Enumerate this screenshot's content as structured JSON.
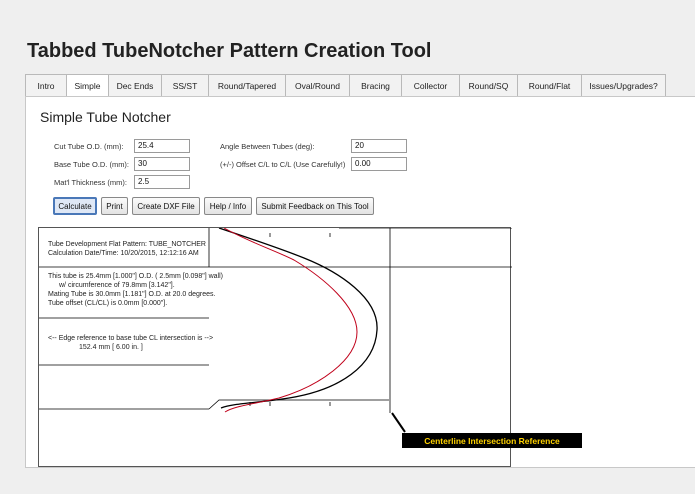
{
  "app": {
    "title": "Tabbed TubeNotcher Pattern Creation Tool"
  },
  "tabs": [
    {
      "label": "Intro",
      "active": false
    },
    {
      "label": "Simple",
      "active": true
    },
    {
      "label": "Dec Ends",
      "active": false
    },
    {
      "label": "SS/ST",
      "active": false
    },
    {
      "label": "Round/Tapered",
      "active": false
    },
    {
      "label": "Oval/Round",
      "active": false
    },
    {
      "label": "Bracing",
      "active": false
    },
    {
      "label": "Collector",
      "active": false
    },
    {
      "label": "Round/SQ",
      "active": false
    },
    {
      "label": "Round/Flat",
      "active": false
    },
    {
      "label": "Issues/Upgrades?",
      "active": false
    }
  ],
  "section": {
    "title": "Simple Tube Notcher"
  },
  "form": {
    "cut_tube_od": {
      "label": "Cut Tube O.D. (mm):",
      "value": "25.4"
    },
    "base_tube_od": {
      "label": "Base Tube O.D. (mm):",
      "value": "30"
    },
    "matl_thickness": {
      "label": "Mat'l Thickness (mm):",
      "value": "2.5"
    },
    "angle": {
      "label": "Angle Between Tubes (deg):",
      "value": "20"
    },
    "offset": {
      "label": "(+/-) Offset C/L to C/L (Use Carefully!)",
      "value": "0.00"
    }
  },
  "buttons": {
    "calculate": "Calculate",
    "print": "Print",
    "create_dxf": "Create DXF File",
    "help": "Help / Info",
    "feedback": "Submit Feedback on This Tool"
  },
  "pattern": {
    "header_line1": "Tube Development Flat Pattern: TUBE_NOTCHER",
    "header_line2": "Calculation Date/Time: 10/20/2015, 12:12:16 AM",
    "info_line1": "This tube is 25.4mm [1.000\"] O.D.     ( 2.5mm [0.098\"] wall)",
    "info_line2": "w/ circumference of 79.8mm [3.142\"].",
    "info_line3": "Mating Tube is 30.0mm [1.181\"] O.D. at 20.0 degrees.",
    "info_line4": "Tube offset (CL/CL) is 0.0mm [0.000\"].",
    "edge_ref": "<-- Edge reference to base tube CL intersection is -->",
    "edge_dist": "152.4 mm   [ 6.00 in. ]",
    "ref_label": "Centerline Intersection Reference",
    "colors": {
      "outer": "#000000",
      "inner": "#c0001a",
      "label_bg": "#000000",
      "label_text": "#ffd200"
    }
  }
}
